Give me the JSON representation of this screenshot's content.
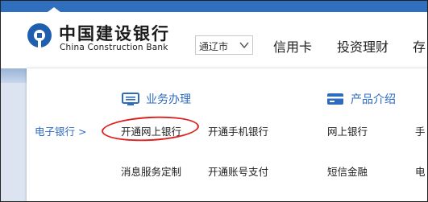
{
  "header": {
    "logo_cn": "中国建设银行",
    "logo_en": "China Construction Bank",
    "city_select": {
      "value": "通辽市"
    },
    "nav": [
      "信用卡",
      "投资理财",
      "存"
    ]
  },
  "menu": {
    "side_label": "电子银行 >",
    "sections": [
      {
        "title": "业务办理",
        "icon": "monitor-icon"
      },
      {
        "title": "产品介绍",
        "icon": "card-icon"
      }
    ],
    "business_links": [
      "开通网上银行",
      "开通手机银行",
      "消息服务定制",
      "开通账号支付"
    ],
    "product_links": [
      "网上银行",
      "手",
      "短信金融",
      "电"
    ]
  },
  "colors": {
    "accent": "#2e6bbf",
    "topbar": "#2f6fbd",
    "highlight_circle": "#e02020"
  }
}
